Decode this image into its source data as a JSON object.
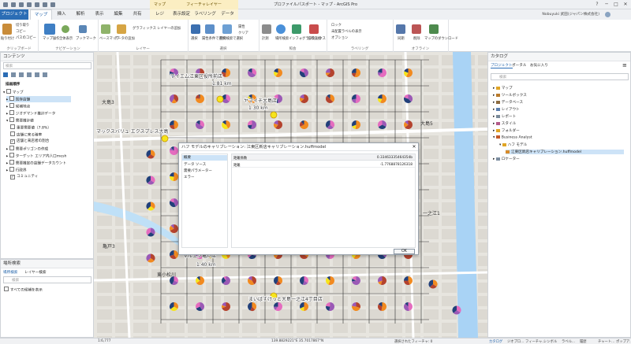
{
  "window": {
    "title": "プロファイルパスポート - マップ - ArcGIS Pro",
    "context_groups": [
      "マップ",
      "フィーチャレイヤー"
    ],
    "controls": [
      "?",
      "─",
      "□",
      "✕"
    ]
  },
  "ribbon_tabs": [
    "プロジェクト",
    "マップ",
    "挿入",
    "解析",
    "表示",
    "編集",
    "共有",
    "レジ",
    "表示設定",
    "ラベリング",
    "データ"
  ],
  "user": {
    "name": "Nobuyuki 武田(ジャパン株式会社)"
  },
  "ribbon_groups": [
    {
      "label": "クリップボード",
      "items": [
        "貼り付け",
        "切り取り",
        "コピー",
        "パスのコピー"
      ]
    },
    {
      "label": "ナビゲーション",
      "items": [
        "マップ操作",
        "全体表示",
        "ブックマーク"
      ]
    },
    {
      "label": "レイヤー",
      "items": [
        "ベースマップ",
        "データの追加",
        "グラフィックス レイヤーの追加"
      ]
    },
    {
      "label": "選択",
      "items": [
        "選択",
        "属性条件で選択",
        "空間検索で選択",
        "属性",
        "クリア"
      ]
    },
    {
      "label": "照会",
      "items": [
        "計測",
        "場所検索",
        "インフォグラフィックス",
        "座標変換"
      ]
    },
    {
      "label": "ラベリング",
      "items": [
        "ロック",
        "未配置ラベルの表示",
        "オプション",
        "ラベリング"
      ]
    },
    {
      "label": "オフライン",
      "items": [
        "同期",
        "削除",
        "マップのダウンロード"
      ]
    }
  ],
  "contents": {
    "title": "コンテンツ",
    "search_placeholder": "検索",
    "section": "描画順序",
    "items": [
      "マップ",
      "既存店舗",
      "候補地点",
      "ジオデマンド推計データ",
      "需要推計値",
      "重要需要値（7.8%）",
      "店舗に来る確率",
      "店舗と来店者の割合",
      "需要ポリゴンの作成",
      "ターゲット エリア内人口mesh",
      "需要推定の店舗データカウント",
      "行政界",
      "コミュニティ"
    ]
  },
  "locate": {
    "title": "場所検索",
    "tabs": [
      "場所検索",
      "レイヤー検索"
    ],
    "placeholder": "検索",
    "option": "すべての候補を表示"
  },
  "map": {
    "labels": {
      "north_store": "ワイエム江東区役所前店",
      "north_dist": "1.81 km",
      "mid_store": "ヤマイチ大島店",
      "mid_dist": "1.30 km",
      "west_store": "マックスバリュ エクスプレス大島",
      "south_store": "マルエツ亀戸店",
      "south_dist": "1.40 km",
      "bottom_store": "まいばすけっと大島一之江4丁目店",
      "town_ojima": "大島3",
      "town_east": "大島5",
      "town_sw": "東小松川",
      "town_kameido": "亀戸3",
      "town_se": "一之江1"
    }
  },
  "dialog": {
    "title": "ハフ モデルのキャリブレーション: 江東区新店キャリブレーション.huffmodel",
    "nav": [
      "概要",
      "データ ソース",
      "需要パラメーター",
      "エラー"
    ],
    "header_label": "距離係数",
    "header_value": "0.33463335464354b",
    "row_label": "距離",
    "row_value": "-1.7768878126318",
    "ok": "OK"
  },
  "catalog": {
    "title": "カタログ",
    "tabs": [
      "プロジェクト",
      "ポータル",
      "お気に入り"
    ],
    "search_placeholder": "検索",
    "items": [
      "マップ",
      "ツールボックス",
      "データベース",
      "レイアウト",
      "レポート",
      "スタイル",
      "フォルダー",
      "Business Analyst",
      "ハフ モデル",
      "江東区新店キャリブレーション.huffmodel",
      "ロケーター"
    ]
  },
  "status": {
    "scale": "1:6,777",
    "coords": "139.8829221°E 35.7017867°N",
    "selected": "選択されたフィーチャ: 0",
    "bottom_tabs": [
      "カタログ",
      "ジオプロ...",
      "フィーチャ...",
      "シンボル",
      "ラベル...",
      "履歴",
      "チャート...",
      "ポップア..."
    ]
  },
  "colors": {
    "pie_orange": "#f28a1f",
    "pie_yellow": "#f6e41c",
    "pie_pink": "#e56cbf",
    "pie_purple": "#9b59b6",
    "pie_navy": "#22407a",
    "pie_red": "#b4432e",
    "river": "#a9d3f5",
    "ribbon_blue": "#2b6db5"
  }
}
